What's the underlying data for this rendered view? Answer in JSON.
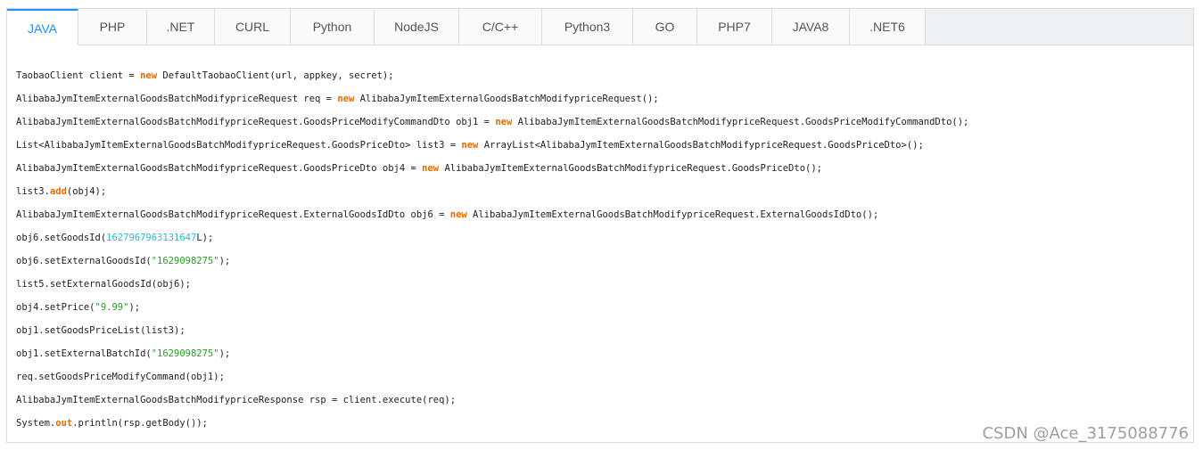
{
  "tabs": [
    {
      "label": "JAVA",
      "width": 80,
      "active": true
    },
    {
      "label": "PHP",
      "width": 77
    },
    {
      "label": ".NET",
      "width": 76
    },
    {
      "label": "CURL",
      "width": 85
    },
    {
      "label": "Python",
      "width": 94
    },
    {
      "label": "NodeJS",
      "width": 95
    },
    {
      "label": "C/C++",
      "width": 93
    },
    {
      "label": "Python3",
      "width": 102
    },
    {
      "label": "GO",
      "width": 72
    },
    {
      "label": "PHP7",
      "width": 84
    },
    {
      "label": "JAVA8",
      "width": 87
    },
    {
      "label": ".NET6",
      "width": 85
    }
  ],
  "code_lines": [
    [
      [
        "t",
        "TaobaoClient client = "
      ],
      [
        "kw",
        "new"
      ],
      [
        "t",
        " DefaultTaobaoClient(url, appkey, secret);"
      ]
    ],
    [
      [
        "t",
        "AlibabaJymItemExternalGoodsBatchModifypriceRequest req = "
      ],
      [
        "kw",
        "new"
      ],
      [
        "t",
        " AlibabaJymItemExternalGoodsBatchModifypriceRequest();"
      ]
    ],
    [
      [
        "t",
        "AlibabaJymItemExternalGoodsBatchModifypriceRequest.GoodsPriceModifyCommandDto obj1 = "
      ],
      [
        "kw",
        "new"
      ],
      [
        "t",
        " AlibabaJymItemExternalGoodsBatchModifypriceRequest.GoodsPriceModifyCommandDto();"
      ]
    ],
    [
      [
        "t",
        "List<AlibabaJymItemExternalGoodsBatchModifypriceRequest.GoodsPriceDto> list3 = "
      ],
      [
        "kw",
        "new"
      ],
      [
        "t",
        " ArrayList<AlibabaJymItemExternalGoodsBatchModifypriceRequest.GoodsPriceDto>();"
      ]
    ],
    [
      [
        "t",
        "AlibabaJymItemExternalGoodsBatchModifypriceRequest.GoodsPriceDto obj4 = "
      ],
      [
        "kw",
        "new"
      ],
      [
        "t",
        " AlibabaJymItemExternalGoodsBatchModifypriceRequest.GoodsPriceDto();"
      ]
    ],
    [
      [
        "t",
        "list3."
      ],
      [
        "kw",
        "add"
      ],
      [
        "t",
        "(obj4);"
      ]
    ],
    [
      [
        "t",
        "AlibabaJymItemExternalGoodsBatchModifypriceRequest.ExternalGoodsIdDto obj6 = "
      ],
      [
        "kw",
        "new"
      ],
      [
        "t",
        " AlibabaJymItemExternalGoodsBatchModifypriceRequest.ExternalGoodsIdDto();"
      ]
    ],
    [
      [
        "t",
        "obj6.setGoodsId("
      ],
      [
        "num",
        "1627967963131647"
      ],
      [
        "t",
        "L);"
      ]
    ],
    [
      [
        "t",
        "obj6.setExternalGoodsId("
      ],
      [
        "str",
        "\"1629098275\""
      ],
      [
        "t",
        ");"
      ]
    ],
    [
      [
        "t",
        "list5.setExternalGoodsId(obj6);"
      ]
    ],
    [
      [
        "t",
        "obj4.setPrice("
      ],
      [
        "str",
        "\"9.99\""
      ],
      [
        "t",
        ");"
      ]
    ],
    [
      [
        "t",
        "obj1.setGoodsPriceList(list3);"
      ]
    ],
    [
      [
        "t",
        "obj1.setExternalBatchId("
      ],
      [
        "str",
        "\"1629098275\""
      ],
      [
        "t",
        ");"
      ]
    ],
    [
      [
        "t",
        "req.setGoodsPriceModifyCommand(obj1);"
      ]
    ],
    [
      [
        "t",
        "AlibabaJymItemExternalGoodsBatchModifypriceResponse rsp = client.execute(req);"
      ]
    ],
    [
      [
        "t",
        "System."
      ],
      [
        "kw",
        "out"
      ],
      [
        "t",
        ".println(rsp.getBody());"
      ]
    ]
  ],
  "watermark": "CSDN @Ace_3175088776"
}
